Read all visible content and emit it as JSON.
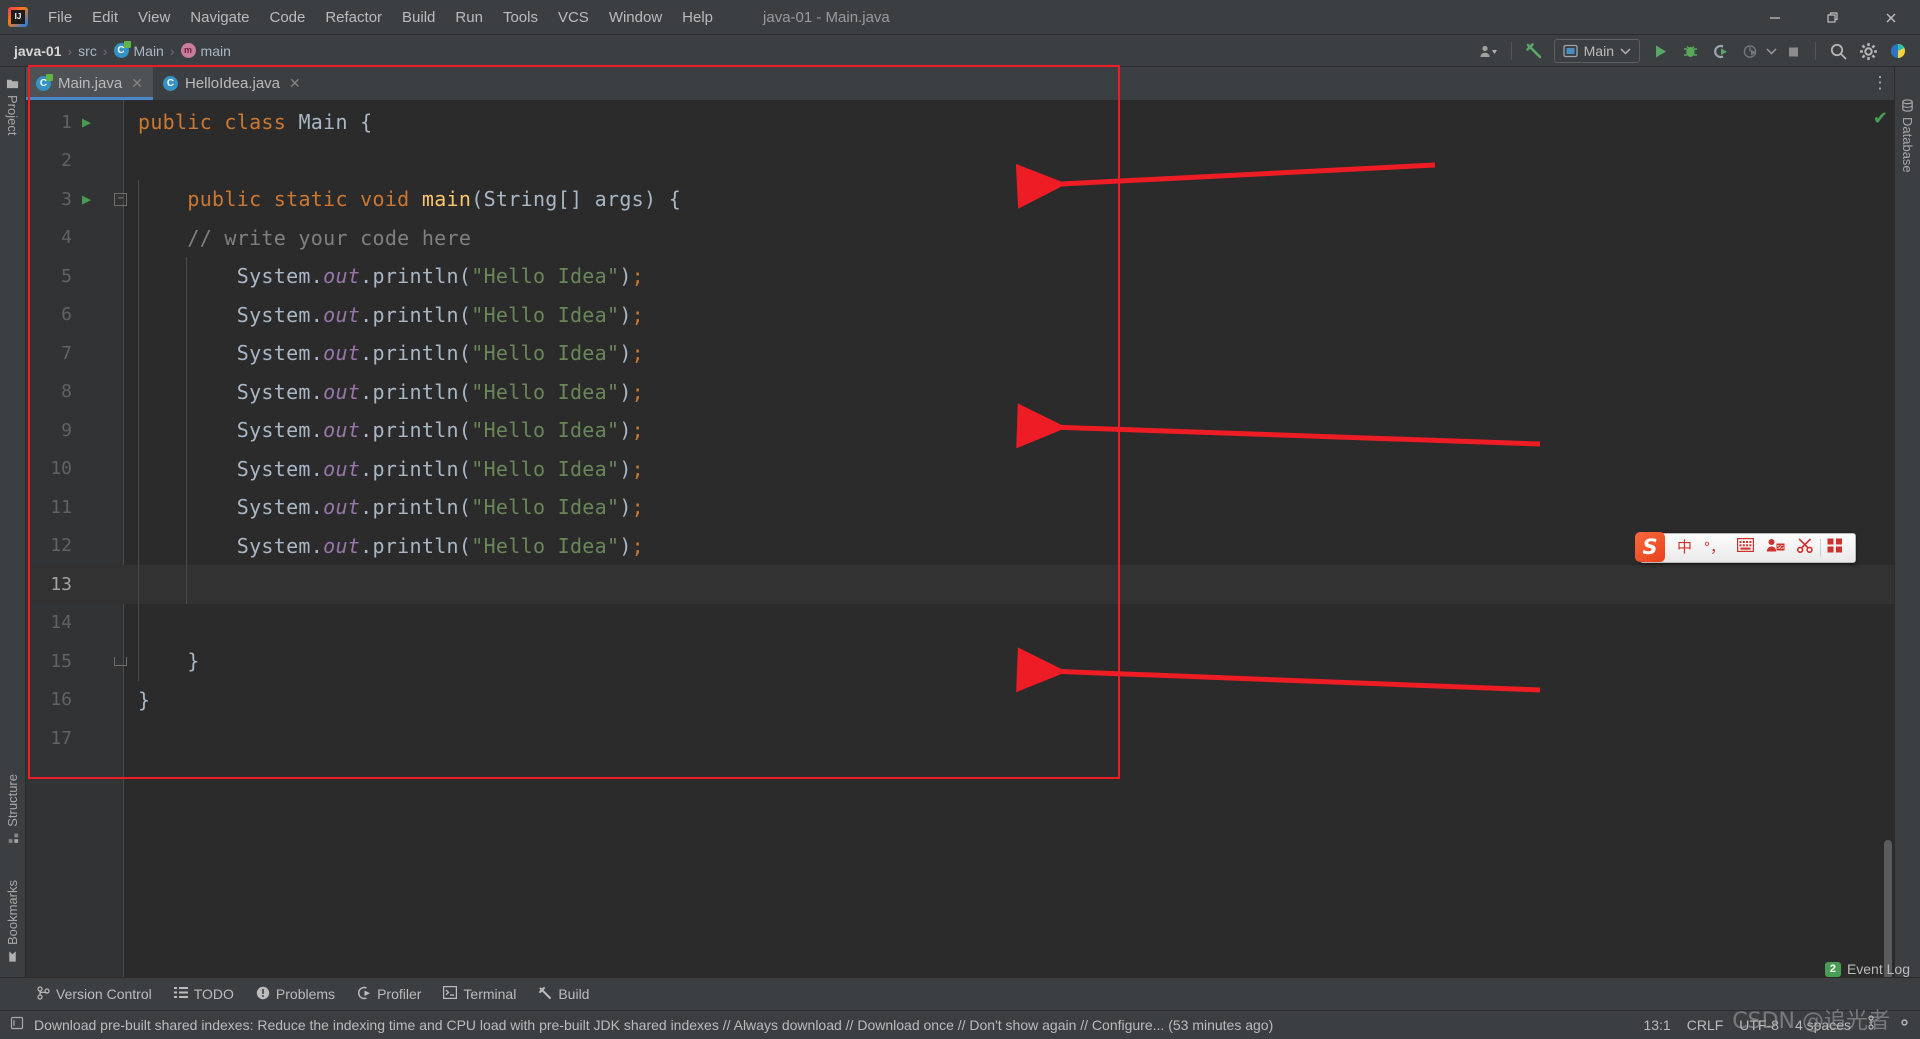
{
  "window": {
    "title": "java-01 - Main.java",
    "controls": [
      {
        "name": "minimize",
        "glyph": "–"
      },
      {
        "name": "restore",
        "glyph": "❐"
      },
      {
        "name": "close",
        "glyph": "✕"
      }
    ]
  },
  "menubar": {
    "items": [
      "File",
      "Edit",
      "View",
      "Navigate",
      "Code",
      "Refactor",
      "Build",
      "Run",
      "Tools",
      "VCS",
      "Window",
      "Help"
    ]
  },
  "breadcrumb": [
    {
      "label": "java-01",
      "icon": "none",
      "bold": true
    },
    {
      "label": "src",
      "icon": "none",
      "bold": false
    },
    {
      "label": "Main",
      "icon": "class-icon",
      "bold": false
    },
    {
      "label": "main",
      "icon": "method-icon",
      "bold": false
    }
  ],
  "toolbar": {
    "account_label": "account-icon",
    "build_label": "build-hammer-icon",
    "run_config": "Main",
    "buttons": [
      {
        "name": "run-button",
        "glyph": "▶",
        "color": "#59a869"
      },
      {
        "name": "debug-button",
        "glyph": "🐞",
        "color": "#5aa85a"
      },
      {
        "name": "run-with-coverage-button",
        "glyph": "C",
        "color": "#9aa7b0"
      },
      {
        "name": "profiler-button",
        "glyph": "◴",
        "color": "#7b8186"
      },
      {
        "name": "stop-button",
        "glyph": "■",
        "color": "#8c8c8c"
      },
      {
        "name": "search-everywhere-button",
        "glyph": "🔍",
        "color": "#b4b4b4"
      },
      {
        "name": "settings-button",
        "glyph": "⚙",
        "color": "#b4b4b4"
      }
    ]
  },
  "tabs": [
    {
      "label": "Main.java",
      "icon": "class-runnable-icon",
      "active": true,
      "close": "✕"
    },
    {
      "label": "HelloIdea.java",
      "icon": "class-icon",
      "active": false,
      "close": "✕"
    }
  ],
  "sidebar_left": [
    {
      "label": "Project",
      "icon": "project-folder-icon",
      "position": "top"
    },
    {
      "label": "Structure",
      "icon": "structure-icon",
      "position": "bottom"
    },
    {
      "label": "Bookmarks",
      "icon": "bookmark-icon",
      "position": "bottom"
    }
  ],
  "sidebar_right": [
    {
      "label": "Database",
      "icon": "database-icon"
    }
  ],
  "editor": {
    "current_line": 13,
    "inspection_status": "✔",
    "lines": [
      {
        "n": 1,
        "run": true,
        "fold": "",
        "indent": 0,
        "tokens": [
          {
            "t": "public",
            "c": "kw"
          },
          {
            "t": " ",
            "c": "pl"
          },
          {
            "t": "class",
            "c": "kw"
          },
          {
            "t": " Main {",
            "c": "pl"
          }
        ]
      },
      {
        "n": 2,
        "run": false,
        "fold": "",
        "indent": 0,
        "tokens": []
      },
      {
        "n": 3,
        "run": true,
        "fold": "start",
        "indent": 1,
        "tokens": [
          {
            "t": "    ",
            "c": "pl"
          },
          {
            "t": "public",
            "c": "kw"
          },
          {
            "t": " ",
            "c": "pl"
          },
          {
            "t": "static",
            "c": "kw"
          },
          {
            "t": " ",
            "c": "pl"
          },
          {
            "t": "void",
            "c": "kw"
          },
          {
            "t": " ",
            "c": "pl"
          },
          {
            "t": "main",
            "c": "mth"
          },
          {
            "t": "(String[] args) {",
            "c": "pl"
          }
        ]
      },
      {
        "n": 4,
        "run": false,
        "fold": "",
        "indent": 1,
        "tokens": [
          {
            "t": "    // write your code here",
            "c": "cmt"
          }
        ]
      },
      {
        "n": 5,
        "run": false,
        "fold": "",
        "indent": 2,
        "tokens": [
          {
            "t": "        System.",
            "c": "pl"
          },
          {
            "t": "out",
            "c": "fld"
          },
          {
            "t": ".println(",
            "c": "pl"
          },
          {
            "t": "\"Hello Idea\"",
            "c": "str"
          },
          {
            "t": ")",
            "c": "pl"
          },
          {
            "t": ";",
            "c": "kw"
          }
        ]
      },
      {
        "n": 6,
        "run": false,
        "fold": "",
        "indent": 2,
        "tokens": [
          {
            "t": "        System.",
            "c": "pl"
          },
          {
            "t": "out",
            "c": "fld"
          },
          {
            "t": ".println(",
            "c": "pl"
          },
          {
            "t": "\"Hello Idea\"",
            "c": "str"
          },
          {
            "t": ")",
            "c": "pl"
          },
          {
            "t": ";",
            "c": "kw"
          }
        ]
      },
      {
        "n": 7,
        "run": false,
        "fold": "",
        "indent": 2,
        "tokens": [
          {
            "t": "        System.",
            "c": "pl"
          },
          {
            "t": "out",
            "c": "fld"
          },
          {
            "t": ".println(",
            "c": "pl"
          },
          {
            "t": "\"Hello Idea\"",
            "c": "str"
          },
          {
            "t": ")",
            "c": "pl"
          },
          {
            "t": ";",
            "c": "kw"
          }
        ]
      },
      {
        "n": 8,
        "run": false,
        "fold": "",
        "indent": 2,
        "tokens": [
          {
            "t": "        System.",
            "c": "pl"
          },
          {
            "t": "out",
            "c": "fld"
          },
          {
            "t": ".println(",
            "c": "pl"
          },
          {
            "t": "\"Hello Idea\"",
            "c": "str"
          },
          {
            "t": ")",
            "c": "pl"
          },
          {
            "t": ";",
            "c": "kw"
          }
        ]
      },
      {
        "n": 9,
        "run": false,
        "fold": "",
        "indent": 2,
        "tokens": [
          {
            "t": "        System.",
            "c": "pl"
          },
          {
            "t": "out",
            "c": "fld"
          },
          {
            "t": ".println(",
            "c": "pl"
          },
          {
            "t": "\"Hello Idea\"",
            "c": "str"
          },
          {
            "t": ")",
            "c": "pl"
          },
          {
            "t": ";",
            "c": "kw"
          }
        ]
      },
      {
        "n": 10,
        "run": false,
        "fold": "",
        "indent": 2,
        "tokens": [
          {
            "t": "        System.",
            "c": "pl"
          },
          {
            "t": "out",
            "c": "fld"
          },
          {
            "t": ".println(",
            "c": "pl"
          },
          {
            "t": "\"Hello Idea\"",
            "c": "str"
          },
          {
            "t": ")",
            "c": "pl"
          },
          {
            "t": ";",
            "c": "kw"
          }
        ]
      },
      {
        "n": 11,
        "run": false,
        "fold": "",
        "indent": 2,
        "tokens": [
          {
            "t": "        System.",
            "c": "pl"
          },
          {
            "t": "out",
            "c": "fld"
          },
          {
            "t": ".println(",
            "c": "pl"
          },
          {
            "t": "\"Hello Idea\"",
            "c": "str"
          },
          {
            "t": ")",
            "c": "pl"
          },
          {
            "t": ";",
            "c": "kw"
          }
        ]
      },
      {
        "n": 12,
        "run": false,
        "fold": "",
        "indent": 2,
        "tokens": [
          {
            "t": "        System.",
            "c": "pl"
          },
          {
            "t": "out",
            "c": "fld"
          },
          {
            "t": ".println(",
            "c": "pl"
          },
          {
            "t": "\"Hello Idea\"",
            "c": "str"
          },
          {
            "t": ")",
            "c": "pl"
          },
          {
            "t": ";",
            "c": "kw"
          }
        ]
      },
      {
        "n": 13,
        "run": false,
        "fold": "",
        "indent": 2,
        "tokens": []
      },
      {
        "n": 14,
        "run": false,
        "fold": "",
        "indent": 1,
        "tokens": []
      },
      {
        "n": 15,
        "run": false,
        "fold": "end",
        "indent": 1,
        "tokens": [
          {
            "t": "    }",
            "c": "pl"
          }
        ]
      },
      {
        "n": 16,
        "run": false,
        "fold": "",
        "indent": 0,
        "tokens": [
          {
            "t": "}",
            "c": "pl"
          }
        ]
      },
      {
        "n": 17,
        "run": false,
        "fold": "",
        "indent": 0,
        "tokens": []
      }
    ]
  },
  "annotations": {
    "rect_color": "#ee1c25",
    "arrow_color": "#ee1c25",
    "arrows": 3,
    "rect_label": "highlight-rectangle"
  },
  "ime": {
    "logo": "S",
    "items": [
      "中",
      "°，",
      "keyboard-icon",
      "user-icon",
      "scissors-icon",
      "apps-grid-icon"
    ]
  },
  "bottom_bar": [
    {
      "label": "Version Control",
      "icon": "branch-icon"
    },
    {
      "label": "TODO",
      "icon": "list-icon"
    },
    {
      "label": "Problems",
      "icon": "warning-icon"
    },
    {
      "label": "Profiler",
      "icon": "gauge-icon"
    },
    {
      "label": "Terminal",
      "icon": "terminal-icon"
    },
    {
      "label": "Build",
      "icon": "hammer-icon"
    }
  ],
  "status": {
    "message": "Download pre-built shared indexes: Reduce the indexing time and CPU load with pre-built JDK shared indexes // Always download // Download once // Don't show again // Configure... (53 minutes ago)",
    "caret": "13:1",
    "line_sep": "CRLF",
    "encoding": "UTF-8",
    "indent": "4 spaces",
    "event_log": "Event Log",
    "event_count": "2",
    "watermark": "CSDN @追光者"
  }
}
